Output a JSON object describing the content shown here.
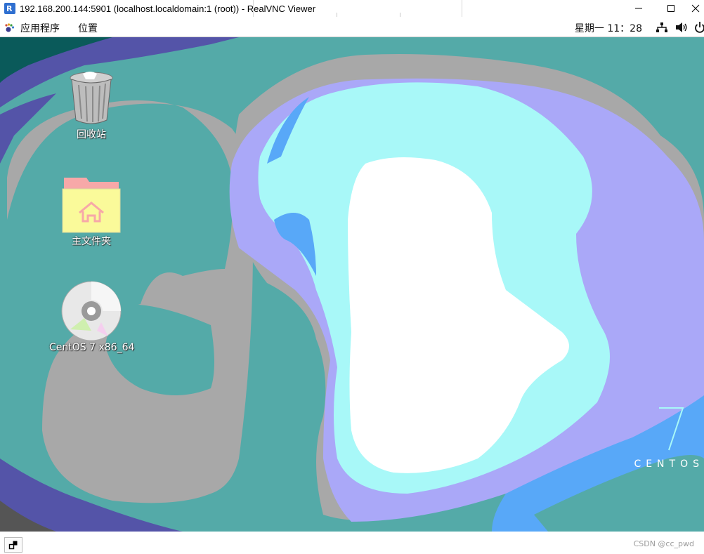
{
  "window": {
    "title": "192.168.200.144:5901 (localhost.localdomain:1 (root)) - RealVNC Viewer",
    "app_icon": "realvnc-icon",
    "controls": [
      "minimize-icon",
      "maximize-icon",
      "close-icon"
    ]
  },
  "topbar": {
    "menus": [
      {
        "label": "应用程序",
        "icon": "gnome-foot-icon"
      },
      {
        "label": "位置"
      }
    ],
    "clock": "星期一 11：28",
    "tray": [
      "network-icon",
      "volume-icon",
      "power-icon"
    ]
  },
  "desktop": {
    "icons": [
      {
        "label": "回收站",
        "icon": "trash-icon"
      },
      {
        "label": "主文件夹",
        "icon": "home-folder-icon"
      },
      {
        "label": "CentOS 7 x86_64",
        "icon": "optical-disc-icon"
      }
    ],
    "brand": "CENTOS",
    "brand_number": "7",
    "wallpaper_colors": [
      "#54aaa8",
      "#a8a8a8",
      "#aaa8f8",
      "#a8f8f8",
      "#ffffff",
      "#58a8f8",
      "#5454a8"
    ]
  },
  "bottombar": {
    "restore_icon": "restore-window-icon",
    "watermark": "CSDN @cc_pwd"
  }
}
